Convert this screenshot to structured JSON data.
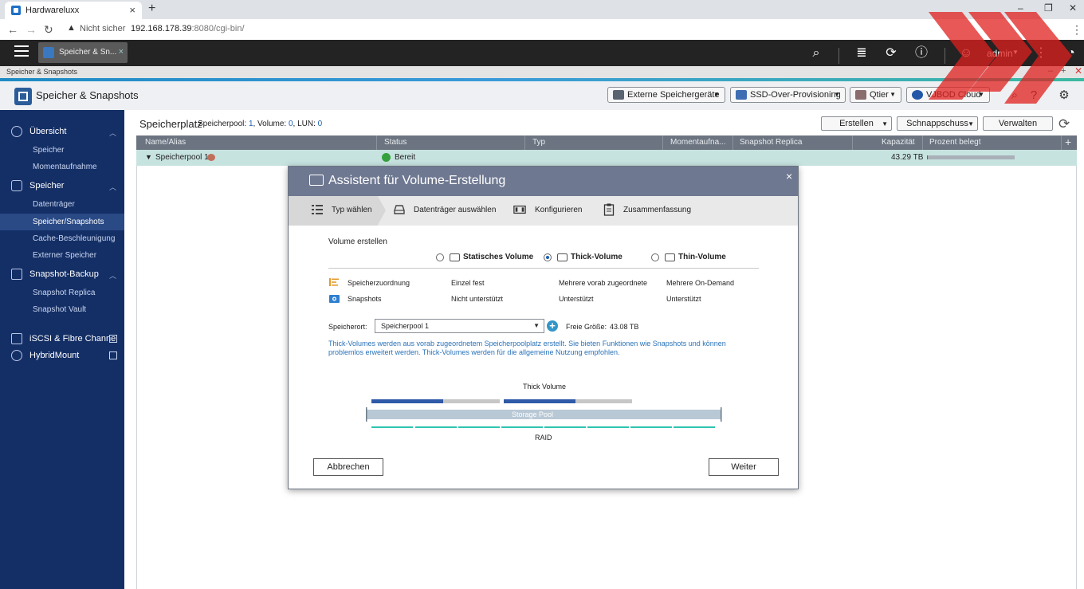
{
  "browser": {
    "tab_title": "Hardwareluxx",
    "tab_close": "×",
    "new_tab": "+",
    "window_controls": [
      "–",
      "❐",
      "✕"
    ],
    "security_label": "Nicht sicher",
    "url_host": "192.168.178.39",
    "url_path": ":8080/cgi-bin/"
  },
  "qts": {
    "app_tab_label": "Speicher & Sn...",
    "app_tab_close": "×",
    "user": "admin"
  },
  "app": {
    "window_title": "Speicher & Snapshots",
    "title": "Speicher & Snapshots",
    "window_controls": [
      "–",
      "+",
      "✕"
    ],
    "header_buttons": [
      {
        "label": "Externe Speichergeräte"
      },
      {
        "label": "SSD-Over-Provisioning"
      },
      {
        "label": "Qtier"
      },
      {
        "label": "VJBOD Cloud"
      }
    ]
  },
  "sidebar": {
    "sections": [
      {
        "label": "Übersicht",
        "items": [
          "Speicher",
          "Momentaufnahme"
        ]
      },
      {
        "label": "Speicher",
        "items": [
          "Datenträger",
          "Speicher/Snapshots",
          "Cache-Beschleunigung",
          "Externer Speicher"
        ]
      },
      {
        "label": "Snapshot-Backup",
        "items": [
          "Snapshot Replica",
          "Snapshot Vault"
        ]
      }
    ],
    "links": [
      "iSCSI & Fibre Channel",
      "HybridMount"
    ],
    "active_item": "Speicher/Snapshots"
  },
  "main": {
    "title": "Speicherplatz",
    "subtitle_prefix_pool": "Speicherpool: ",
    "pool_count": "1",
    "subtitle_prefix_volume": ", Volume: ",
    "volume_count": "0",
    "subtitle_prefix_lun": ", LUN: ",
    "lun_count": "0",
    "buttons": {
      "create": "Erstellen",
      "snapshot": "Schnappschuss",
      "manage": "Verwalten"
    },
    "table": {
      "columns": [
        "Name/Alias",
        "Status",
        "Typ",
        "Momentaufna...",
        "Snapshot Replica",
        "Kapazität",
        "Prozent belegt"
      ],
      "add": "+",
      "rows": [
        {
          "name": "Speicherpool 1",
          "status": "Bereit",
          "type": "",
          "capacity": "43.29 TB",
          "percent_used": 0.01
        }
      ]
    }
  },
  "modal": {
    "title": "Assistent für Volume-Erstellung",
    "close": "×",
    "steps": [
      "Typ wählen",
      "Datenträger auswählen",
      "Konfigurieren",
      "Zusammenfassung"
    ],
    "active_step": "Typ wählen",
    "section_title": "Volume erstellen",
    "options": [
      {
        "label": "Statisches Volume",
        "selected": false
      },
      {
        "label": "Thick-Volume",
        "selected": true
      },
      {
        "label": "Thin-Volume",
        "selected": false
      }
    ],
    "features": [
      {
        "label": "Speicherzuordnung",
        "values": [
          "Einzel fest",
          "Mehrere vorab zugeordnete",
          "Mehrere On-Demand"
        ]
      },
      {
        "label": "Snapshots",
        "values": [
          "Nicht unterstützt",
          "Unterstützt",
          "Unterstützt"
        ]
      }
    ],
    "location_label": "Speicherort:",
    "location_value": "Speicherpool 1",
    "free_label": "Freie Größe:",
    "free_value": "43.08 TB",
    "description": "Thick-Volumes werden aus vorab zugeordnetem Speicherpoolplatz erstellt. Sie bieten Funktionen wie Snapshots und können problemlos erweitert werden. Thick-Volumes werden für die allgemeine Nutzung empfohlen.",
    "diagram": {
      "title": "Thick Volume",
      "pool_label": "Storage Pool",
      "raid_label": "RAID"
    },
    "cancel": "Abbrechen",
    "next": "Weiter"
  },
  "colors": {
    "sidebar_bg": "#142f66",
    "accent_blue": "#2e5aa8",
    "raid_teal": "#2ec4b0",
    "modal_header": "#6e7891",
    "watermark_red": "#e0201e"
  }
}
